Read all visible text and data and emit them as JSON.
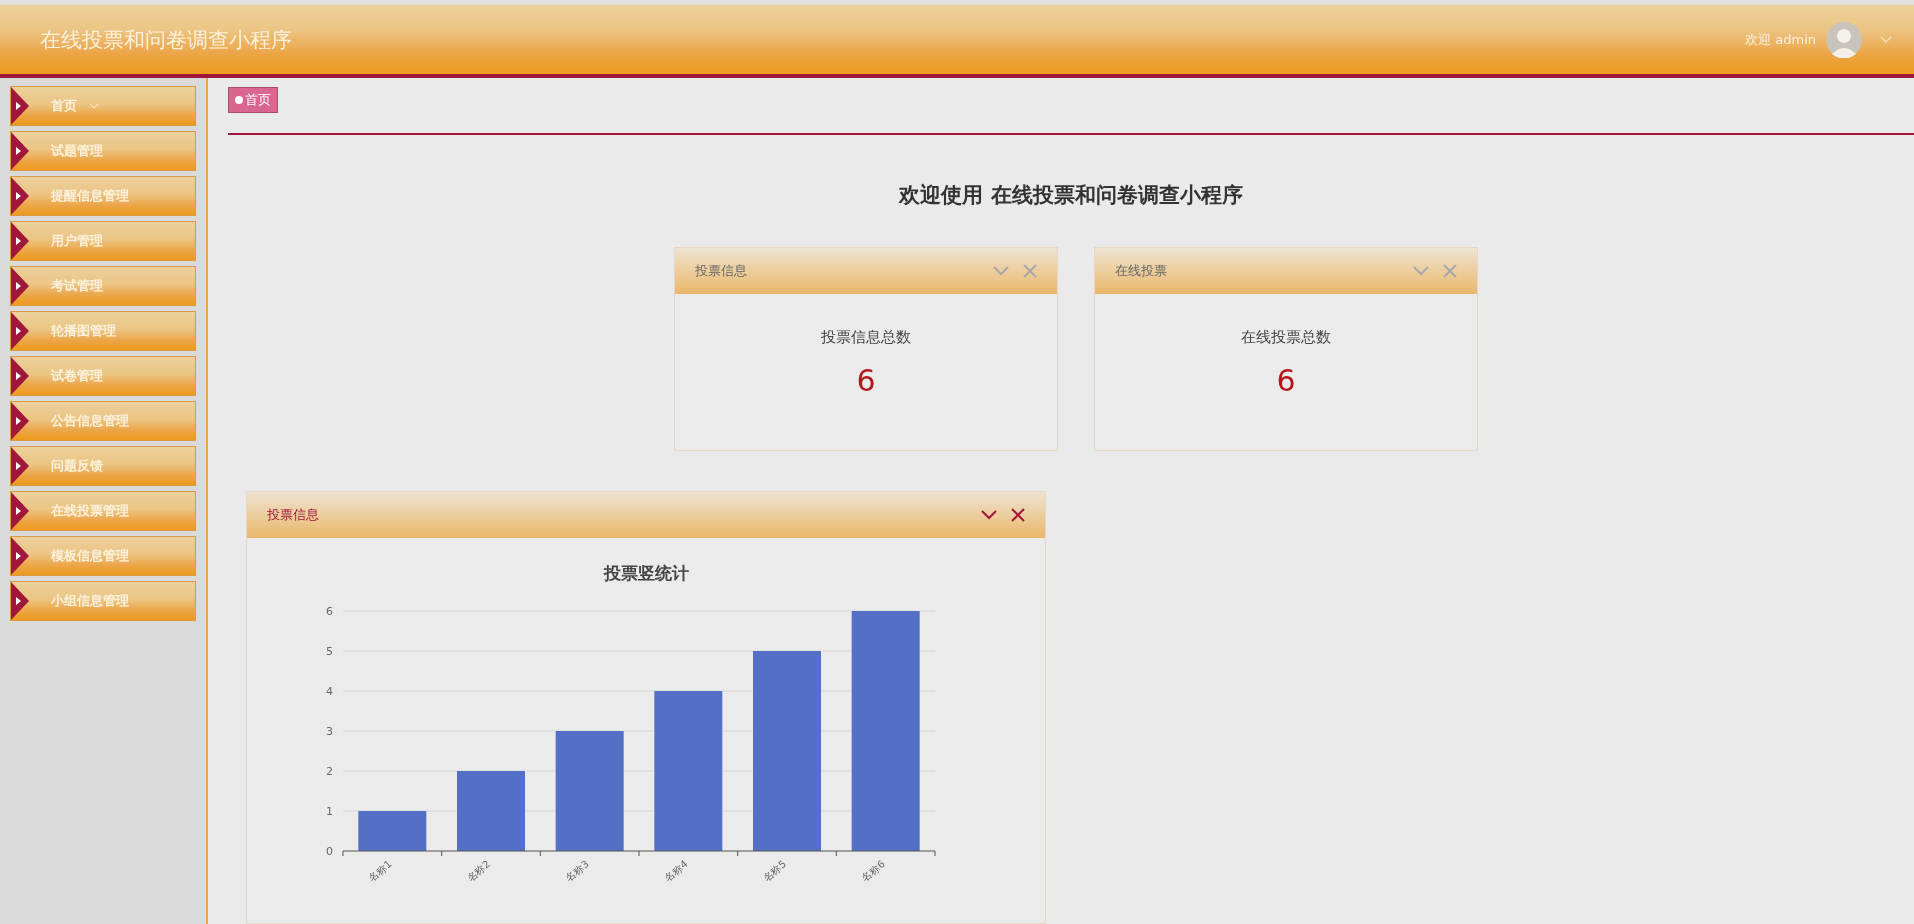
{
  "header": {
    "title": "在线投票和问卷调查小程序",
    "greeting": "欢迎 admin"
  },
  "sidebar": {
    "items": [
      {
        "label": "首页",
        "kind": "dropdown"
      },
      {
        "label": "试题管理",
        "kind": "link"
      },
      {
        "label": "提醒信息管理",
        "kind": "link"
      },
      {
        "label": "用户管理",
        "kind": "link"
      },
      {
        "label": "考试管理",
        "kind": "link"
      },
      {
        "label": "轮播图管理",
        "kind": "link"
      },
      {
        "label": "试卷管理",
        "kind": "link"
      },
      {
        "label": "公告信息管理",
        "kind": "link"
      },
      {
        "label": "问题反馈",
        "kind": "link"
      },
      {
        "label": "在线投票管理",
        "kind": "link"
      },
      {
        "label": "模板信息管理",
        "kind": "link"
      },
      {
        "label": "小组信息管理",
        "kind": "link"
      }
    ]
  },
  "breadcrumb": {
    "label": "首页"
  },
  "welcome": "欢迎使用 在线投票和问卷调查小程序",
  "stat_panels": [
    {
      "title": "投票信息",
      "label": "投票信息总数",
      "value": "6",
      "highlighted": false
    },
    {
      "title": "在线投票",
      "label": "在线投票总数",
      "value": "6",
      "highlighted": false
    }
  ],
  "chart_panel": {
    "title": "投票信息",
    "highlighted": true,
    "chart_data": {
      "type": "bar",
      "title": "投票竖统计",
      "categories": [
        "名称1",
        "名称2",
        "名称3",
        "名称4",
        "名称5",
        "名称6"
      ],
      "values": [
        1,
        2,
        3,
        4,
        5,
        6
      ],
      "color": "#5470c6",
      "ylim": [
        0,
        6
      ],
      "yticks": [
        0,
        1,
        2,
        3,
        4,
        5,
        6
      ],
      "grid": true
    }
  }
}
